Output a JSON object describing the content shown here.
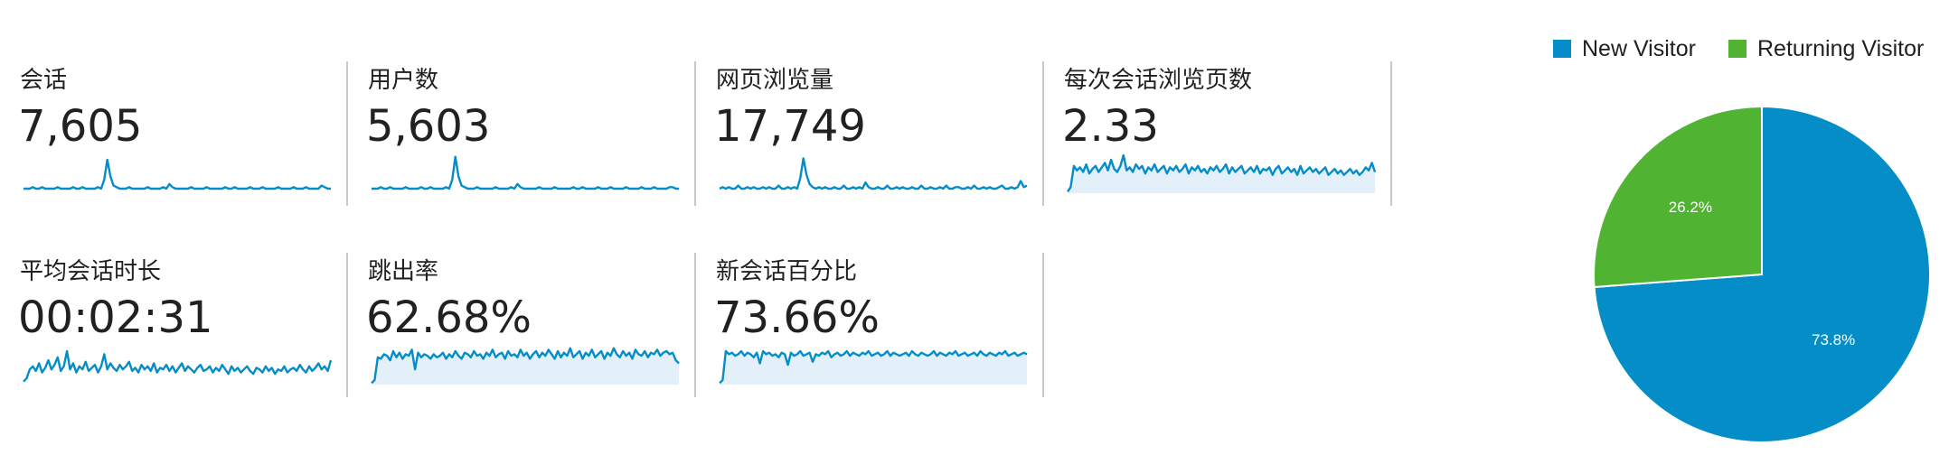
{
  "metrics": [
    {
      "label": "会话",
      "value": "7,605",
      "fill": false,
      "spark": [
        3,
        3,
        3,
        4,
        3,
        3,
        4,
        3,
        3,
        3,
        3,
        4,
        3,
        3,
        3,
        3,
        4,
        3,
        3,
        4,
        3,
        3,
        3,
        3,
        4,
        3,
        9,
        22,
        11,
        5,
        4,
        3,
        3,
        3,
        4,
        3,
        3,
        3,
        3,
        3,
        4,
        3,
        3,
        3,
        3,
        4,
        3,
        6,
        4,
        3,
        3,
        3,
        3,
        3,
        4,
        3,
        3,
        3,
        3,
        4,
        3,
        3,
        3,
        3,
        3,
        4,
        3,
        3,
        4,
        3,
        3,
        3,
        3,
        4,
        3,
        3,
        3,
        4,
        3,
        3,
        3,
        3,
        4,
        3,
        3,
        3,
        3,
        4,
        3,
        3,
        3,
        4,
        3,
        3,
        3,
        3,
        5,
        4,
        3,
        3
      ]
    },
    {
      "label": "用户数",
      "value": "5,603",
      "fill": false,
      "spark": [
        3,
        3,
        3,
        4,
        3,
        3,
        4,
        3,
        3,
        3,
        3,
        4,
        3,
        3,
        3,
        3,
        4,
        3,
        3,
        4,
        3,
        3,
        3,
        3,
        4,
        3,
        9,
        24,
        11,
        5,
        4,
        3,
        3,
        3,
        4,
        3,
        3,
        3,
        3,
        3,
        4,
        3,
        3,
        3,
        3,
        4,
        3,
        6,
        4,
        3,
        3,
        3,
        3,
        3,
        4,
        3,
        3,
        3,
        3,
        4,
        3,
        3,
        3,
        3,
        3,
        4,
        3,
        3,
        4,
        3,
        3,
        3,
        3,
        4,
        3,
        3,
        3,
        4,
        3,
        3,
        3,
        3,
        4,
        3,
        3,
        3,
        3,
        4,
        3,
        3,
        3,
        4,
        3,
        3,
        3,
        3,
        4,
        4,
        3,
        3
      ]
    },
    {
      "label": "网页浏览量",
      "value": "17,749",
      "fill": false,
      "spark": [
        3,
        4,
        3,
        4,
        3,
        3,
        5,
        3,
        3,
        4,
        3,
        4,
        3,
        3,
        4,
        3,
        4,
        3,
        3,
        5,
        3,
        3,
        4,
        3,
        4,
        3,
        10,
        23,
        12,
        6,
        4,
        3,
        4,
        3,
        4,
        3,
        3,
        4,
        3,
        3,
        5,
        3,
        3,
        4,
        3,
        4,
        3,
        7,
        4,
        3,
        3,
        4,
        3,
        3,
        5,
        3,
        3,
        4,
        3,
        4,
        3,
        3,
        4,
        3,
        3,
        5,
        3,
        3,
        4,
        3,
        3,
        4,
        3,
        5,
        3,
        3,
        4,
        4,
        3,
        3,
        4,
        3,
        5,
        3,
        3,
        4,
        3,
        4,
        3,
        3,
        4,
        5,
        3,
        3,
        4,
        3,
        4,
        8,
        4,
        5
      ]
    },
    {
      "label": "每次会话浏览页数",
      "value": "2.33",
      "fill": true,
      "spark": [
        1,
        4,
        18,
        15,
        17,
        14,
        19,
        13,
        16,
        18,
        14,
        17,
        20,
        15,
        22,
        16,
        14,
        18,
        25,
        15,
        17,
        14,
        19,
        16,
        18,
        13,
        17,
        15,
        19,
        14,
        16,
        18,
        13,
        17,
        15,
        18,
        14,
        16,
        19,
        13,
        17,
        15,
        18,
        14,
        16,
        13,
        17,
        15,
        18,
        14,
        16,
        19,
        13,
        17,
        14,
        16,
        18,
        13,
        15,
        17,
        14,
        18,
        13,
        16,
        15,
        17,
        12,
        16,
        18,
        13,
        15,
        17,
        14,
        16,
        12,
        18,
        13,
        15,
        17,
        14,
        16,
        13,
        15,
        17,
        12,
        14,
        16,
        13,
        15,
        12,
        14,
        16,
        13,
        15,
        12,
        14,
        17,
        15,
        20,
        14
      ]
    },
    {
      "label": "平均会话时长",
      "value": "00:02:31",
      "fill": false,
      "spark": [
        2,
        4,
        10,
        12,
        9,
        14,
        8,
        11,
        16,
        10,
        13,
        18,
        9,
        12,
        22,
        10,
        14,
        8,
        12,
        10,
        15,
        9,
        11,
        13,
        8,
        12,
        20,
        10,
        14,
        11,
        9,
        13,
        10,
        12,
        15,
        9,
        11,
        8,
        13,
        10,
        12,
        9,
        14,
        8,
        11,
        10,
        13,
        9,
        12,
        8,
        11,
        14,
        9,
        12,
        10,
        8,
        11,
        13,
        9,
        10,
        12,
        8,
        11,
        9,
        13,
        10,
        7,
        12,
        9,
        11,
        8,
        10,
        12,
        9,
        7,
        11,
        10,
        8,
        12,
        9,
        11,
        7,
        10,
        9,
        12,
        8,
        10,
        11,
        9,
        13,
        10,
        8,
        12,
        9,
        11,
        14,
        10,
        12,
        9,
        16
      ]
    },
    {
      "label": "跳出率",
      "value": "62.68%",
      "fill": true,
      "spark": [
        1,
        3,
        18,
        17,
        20,
        19,
        16,
        22,
        18,
        21,
        17,
        20,
        19,
        23,
        10,
        21,
        18,
        20,
        19,
        17,
        20,
        18,
        19,
        21,
        17,
        20,
        18,
        22,
        19,
        17,
        21,
        20,
        18,
        22,
        19,
        20,
        17,
        21,
        19,
        23,
        18,
        20,
        21,
        17,
        22,
        19,
        20,
        18,
        23,
        19,
        21,
        17,
        20,
        22,
        18,
        21,
        19,
        23,
        20,
        17,
        22,
        18,
        21,
        19,
        24,
        18,
        20,
        22,
        17,
        21,
        19,
        23,
        18,
        20,
        22,
        17,
        21,
        19,
        24,
        20,
        18,
        22,
        19,
        21,
        17,
        23,
        20,
        19,
        22,
        18,
        21,
        20,
        23,
        19,
        21,
        22,
        20,
        21,
        16,
        14
      ]
    },
    {
      "label": "新会话百分比",
      "value": "73.66%",
      "fill": true,
      "spark": [
        1,
        3,
        22,
        20,
        21,
        19,
        20,
        22,
        19,
        21,
        20,
        18,
        21,
        14,
        22,
        20,
        21,
        19,
        20,
        18,
        21,
        20,
        13,
        21,
        19,
        20,
        22,
        19,
        20,
        21,
        15,
        20,
        19,
        21,
        20,
        22,
        18,
        20,
        21,
        19,
        20,
        22,
        19,
        21,
        20,
        19,
        21,
        20,
        22,
        19,
        20,
        21,
        19,
        20,
        22,
        19,
        21,
        20,
        19,
        20,
        21,
        19,
        22,
        20,
        19,
        21,
        20,
        19,
        20,
        22,
        19,
        21,
        20,
        19,
        21,
        20,
        22,
        19,
        20,
        21,
        19,
        20,
        21,
        19,
        22,
        20,
        19,
        21,
        20,
        19,
        21,
        20,
        22,
        19,
        20,
        21,
        19,
        20,
        21,
        20
      ]
    }
  ],
  "chart_data": {
    "type": "pie",
    "legend_position": "top-right",
    "categories": [
      "New Visitor",
      "Returning Visitor"
    ],
    "values": [
      73.8,
      26.2
    ],
    "value_labels": [
      "73.8%",
      "26.2%"
    ],
    "colors": [
      "#058dc7",
      "#50b432"
    ]
  },
  "theme": {
    "spark_line": "#058dc7",
    "spark_fill": "#e3f0f9"
  }
}
